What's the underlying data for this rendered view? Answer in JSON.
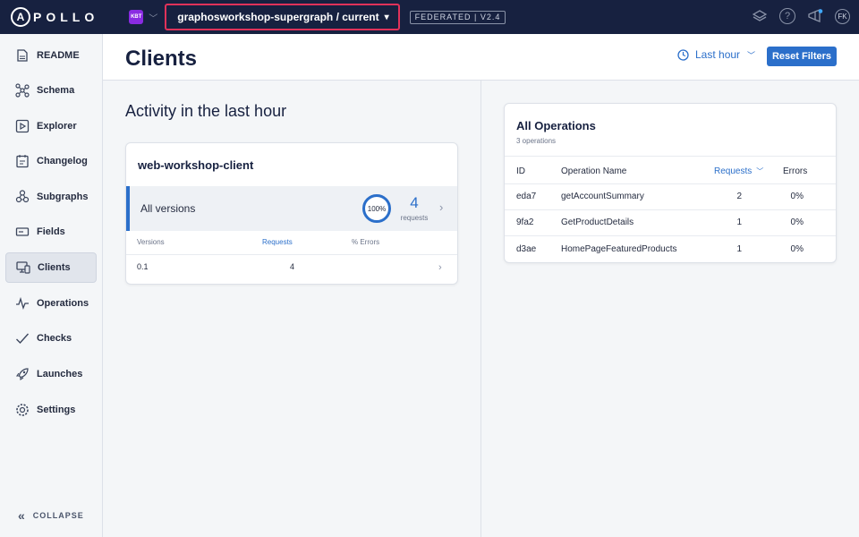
{
  "topbar": {
    "logo_letter": "A",
    "logo_text": "POLLO",
    "org_badge": "KBT",
    "graph_selector": "graphosworkshop-supergraph / current",
    "federation_badge": "FEDERATED | V2.4",
    "avatar_initials": "FK",
    "icons": [
      "layers-icon",
      "help-icon",
      "megaphone-icon",
      "avatar"
    ]
  },
  "sidebar": {
    "items": [
      {
        "label": "README",
        "icon": "readme-icon"
      },
      {
        "label": "Schema",
        "icon": "schema-icon"
      },
      {
        "label": "Explorer",
        "icon": "explorer-icon"
      },
      {
        "label": "Changelog",
        "icon": "changelog-icon"
      },
      {
        "label": "Subgraphs",
        "icon": "subgraphs-icon"
      },
      {
        "label": "Fields",
        "icon": "fields-icon"
      },
      {
        "label": "Clients",
        "icon": "clients-icon",
        "active": true
      },
      {
        "label": "Operations",
        "icon": "operations-icon"
      },
      {
        "label": "Checks",
        "icon": "checks-icon"
      },
      {
        "label": "Launches",
        "icon": "launches-icon"
      },
      {
        "label": "Settings",
        "icon": "settings-icon"
      }
    ],
    "collapse_label": "COLLAPSE"
  },
  "header": {
    "title": "Clients",
    "time_range": "Last hour",
    "reset_label": "Reset Filters"
  },
  "activity": {
    "title": "Activity in the last hour",
    "client": {
      "name": "web-workshop-client",
      "all_versions_label": "All versions",
      "percent_label": "100%",
      "percent_value": 1.0,
      "request_count": "4",
      "request_count_label": "requests",
      "columns": [
        "Versions",
        "Requests",
        "% Errors"
      ],
      "rows": [
        {
          "version": "0.1",
          "requests": "4",
          "errors": ""
        }
      ]
    }
  },
  "operations": {
    "title": "All Operations",
    "subtitle": "3 operations",
    "columns": {
      "id": "ID",
      "name": "Operation Name",
      "requests": "Requests",
      "errors": "Errors"
    },
    "rows": [
      {
        "id": "eda7",
        "name": "getAccountSummary",
        "requests": "2",
        "errors": "0%"
      },
      {
        "id": "9fa2",
        "name": "GetProductDetails",
        "requests": "1",
        "errors": "0%"
      },
      {
        "id": "d3ae",
        "name": "HomePageFeaturedProducts",
        "requests": "1",
        "errors": "0%"
      }
    ]
  },
  "colors": {
    "topbar": "#172140",
    "accent": "#2b6fca",
    "highlight_border": "#e0325a",
    "org_badge": "#8a2be2"
  }
}
